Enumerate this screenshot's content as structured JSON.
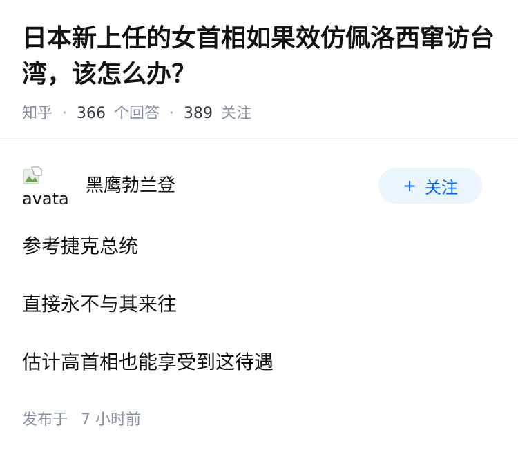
{
  "question": {
    "title": "日本新上任的女首相如果效仿佩洛西窜访台湾，该怎么办？",
    "source": "知乎",
    "answers_count": "366",
    "answers_label": "个回答",
    "follows_count": "389",
    "follows_label": "关注"
  },
  "answer": {
    "avatar_alt": "avatar",
    "author_name": "黑鹰勃兰登",
    "follow_button": "+ 关注",
    "follow_plus": "+",
    "follow_label": "关注",
    "paragraphs": [
      "参考捷克总统",
      "直接永不与其来往",
      "估计高首相也能享受到这待遇"
    ],
    "time_prefix": "发布于",
    "time_value": "7 小时前"
  },
  "colors": {
    "accent": "#0066ff",
    "follow_bg": "#ebf5ff",
    "meta_gray": "#8590a6",
    "text": "#121212"
  }
}
